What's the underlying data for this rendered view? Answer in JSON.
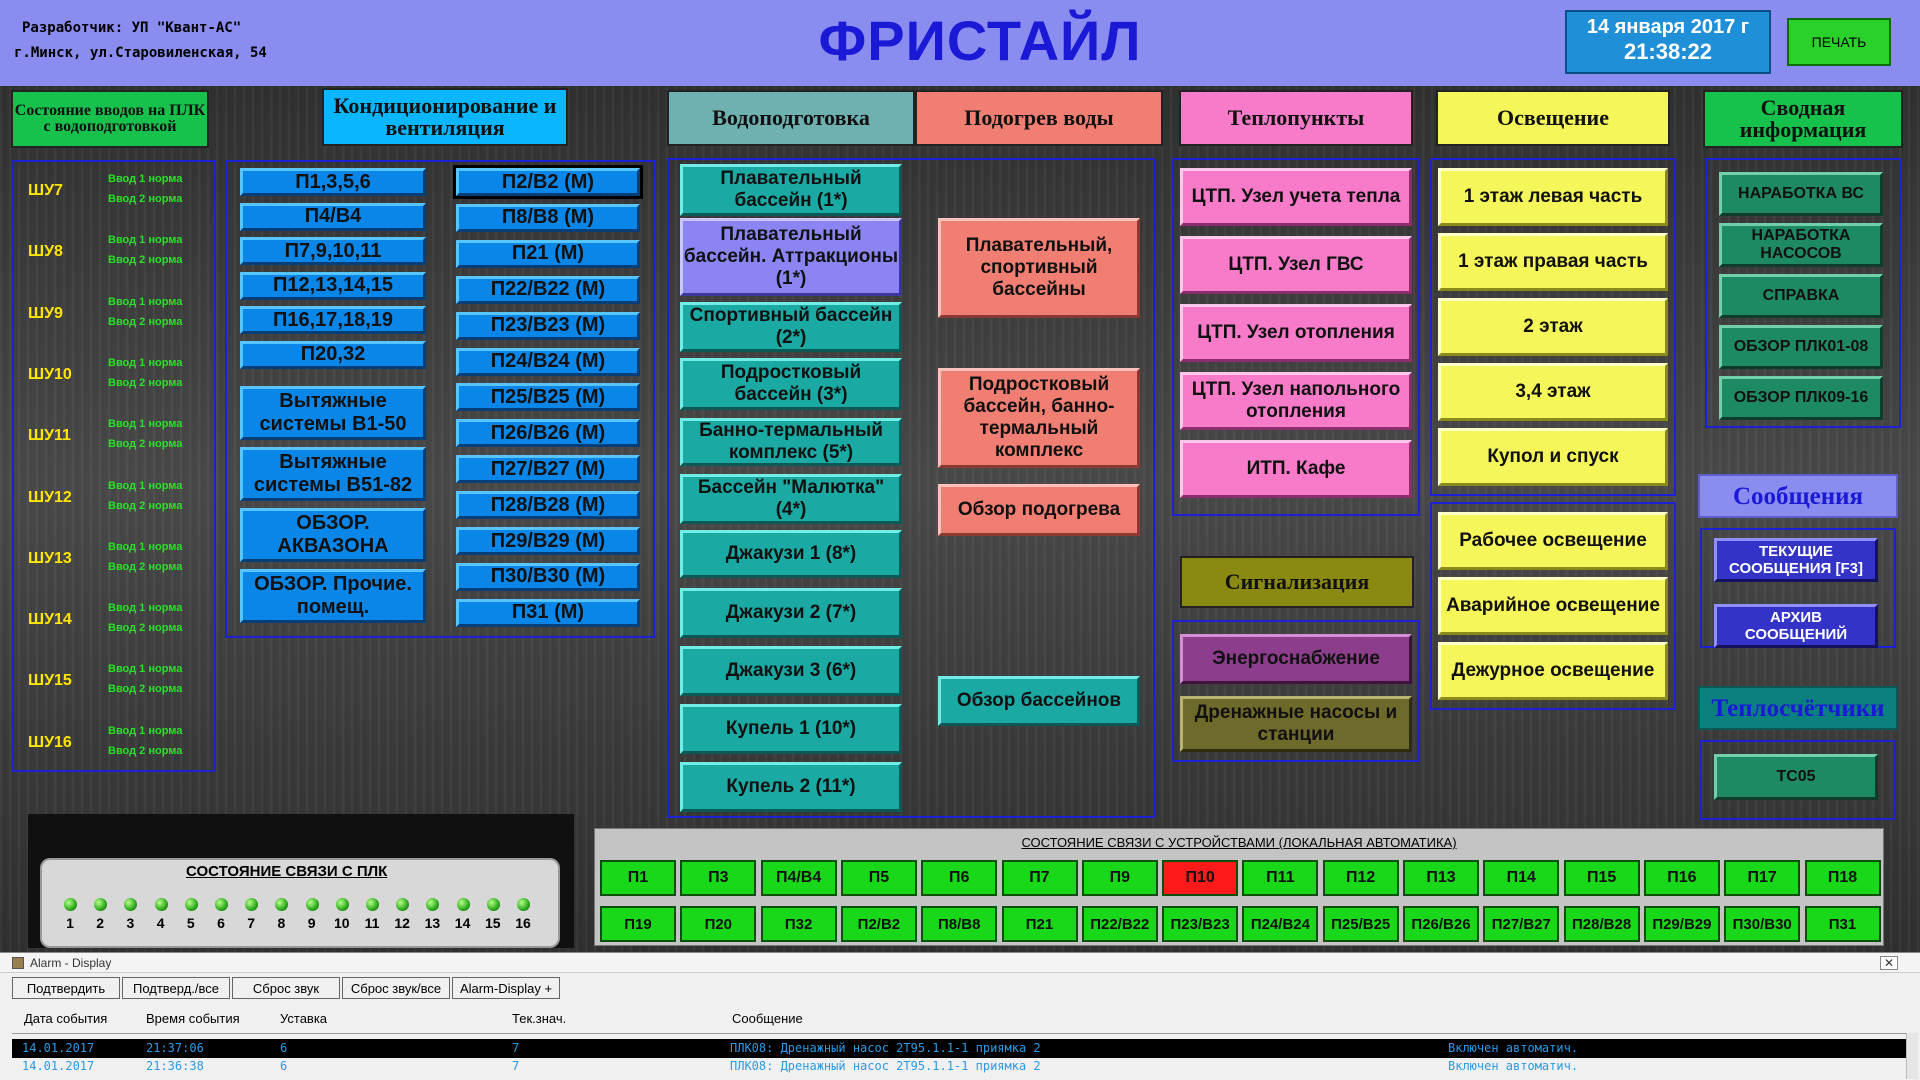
{
  "header": {
    "developer_line1": "Разработчик: УП \"Квант-АС\"",
    "developer_line2": "г.Минск, ул.Старовиленская, 54",
    "title": "ФРИСТАЙЛ",
    "date": "14 января 2017 г",
    "time": "21:38:22",
    "print_label": "ПЕЧАТЬ"
  },
  "colors": {
    "header_bg": "#8a8cf0",
    "title": "#1a1ad6",
    "accent_blue": "#1b22d2",
    "alarm_row_text": "#2a9be5"
  },
  "sections": {
    "inputs_state": "Состояние вводов на ПЛК с водоподготовкой",
    "hvac": "Кондиционирование и вентиляция",
    "water_treatment": "Водоподготовка",
    "water_heating": "Подогрев воды",
    "heat_points": "Теплопункты",
    "lighting": "Освещение",
    "summary": "Сводная информация",
    "messages": "Сообщения",
    "signaling": "Сигнализация",
    "heat_meters": "Теплосчётчики"
  },
  "shu": [
    {
      "label": "ШУ7",
      "in1": "Ввод 1 норма",
      "in2": "Ввод 2 норма"
    },
    {
      "label": "ШУ8",
      "in1": "Ввод 1 норма",
      "in2": "Ввод 2 норма"
    },
    {
      "label": "ШУ9",
      "in1": "Ввод 1 норма",
      "in2": "Ввод 2 норма"
    },
    {
      "label": "ШУ10",
      "in1": "Ввод 1 норма",
      "in2": "Ввод 2 норма"
    },
    {
      "label": "ШУ11",
      "in1": "Ввод 1 норма",
      "in2": "Ввод 2 норма"
    },
    {
      "label": "ШУ12",
      "in1": "Ввод 1 норма",
      "in2": "Ввод 2 норма"
    },
    {
      "label": "ШУ13",
      "in1": "Ввод 1 норма",
      "in2": "Ввод 2 норма"
    },
    {
      "label": "ШУ14",
      "in1": "Ввод 1 норма",
      "in2": "Ввод 2 норма"
    },
    {
      "label": "ШУ15",
      "in1": "Ввод 1 норма",
      "in2": "Ввод 2 норма"
    },
    {
      "label": "ШУ16",
      "in1": "Ввод 1 норма",
      "in2": "Ввод 2 норма"
    }
  ],
  "hvac_left": [
    "П1,3,5,6",
    "П4/В4",
    "П7,9,10,11",
    "П12,13,14,15",
    "П16,17,18,19",
    "П20,32"
  ],
  "hvac_left_big": [
    "Вытяжные системы В1-50",
    "Вытяжные системы В51-82",
    "ОБЗОР. АКВАЗОНА",
    "ОБЗОР. Прочие. помещ."
  ],
  "hvac_right": [
    "П2/В2 (М)",
    "П8/В8 (М)",
    "П21 (М)",
    "П22/В22 (М)",
    "П23/В23 (М)",
    "П24/В24 (М)",
    "П25/В25 (М)",
    "П26/В26 (М)",
    "П27/В27 (М)",
    "П28/В28 (М)",
    "П29/В29 (М)",
    "П30/В30 (М)",
    "П31 (М)"
  ],
  "water": [
    "Плавательный бассейн (1*)",
    "Плавательный бассейн. Аттракционы (1*)",
    "Спортивный бассейн (2*)",
    "Подростковый бассейн (3*)",
    "Банно-термальный комплекс (5*)",
    "Бассейн \"Малютка\" (4*)",
    "Джакузи 1 (8*)",
    "Джакузи 2 (7*)",
    "Джакузи 3 (6*)",
    "Купель 1 (10*)",
    "Купель 2 (11*)"
  ],
  "heating": [
    "Плавательный, спортивный бассейны",
    "Подростковый бассейн, банно-термальный комплекс",
    "Обзор подогрева",
    "Обзор бассейнов"
  ],
  "heat_points": [
    "ЦТП. Узел учета тепла",
    "ЦТП. Узел ГВС",
    "ЦТП. Узел отопления",
    "ЦТП. Узел напольного отопления",
    "ИТП. Кафе"
  ],
  "signaling": [
    "Энергоснабжение",
    "Дренажные насосы и станции"
  ],
  "lighting": [
    "1 этаж левая часть",
    "1 этаж правая часть",
    "2 этаж",
    "3,4 этаж",
    "Купол и спуск"
  ],
  "lighting2": [
    "Рабочее освещение",
    "Аварийное освещение",
    "Дежурное освещение"
  ],
  "summary": [
    "НАРАБОТКА ВС",
    "НАРАБОТКА НАСОСОВ",
    "СПРАВКА",
    "ОБЗОР ПЛК01-08",
    "ОБЗОР ПЛК09-16"
  ],
  "messages": [
    "ТЕКУЩИЕ СООБЩЕНИЯ [F3]",
    "АРХИВ СООБЩЕНИЙ"
  ],
  "heat_meters": [
    "ТС05"
  ],
  "plc": {
    "title": "СОСТОЯНИЕ СВЯЗИ С ПЛК",
    "nums": [
      "1",
      "2",
      "3",
      "4",
      "5",
      "6",
      "7",
      "8",
      "9",
      "10",
      "11",
      "12",
      "13",
      "14",
      "15",
      "16"
    ]
  },
  "devices": {
    "title": "СОСТОЯНИЕ СВЯЗИ С УСТРОЙСТВАМИ (ЛОКАЛЬНАЯ АВТОМАТИКА)",
    "row1": [
      "П1",
      "П3",
      "П4/В4",
      "П5",
      "П6",
      "П7",
      "П9",
      "П10",
      "П11",
      "П12",
      "П13",
      "П14",
      "П15",
      "П16",
      "П17",
      "П18"
    ],
    "row2": [
      "П19",
      "П20",
      "П32",
      "П2/В2",
      "П8/В8",
      "П21",
      "П22/В22",
      "П23/В23",
      "П24/В24",
      "П25/В25",
      "П26/В26",
      "П27/В27",
      "П28/В28",
      "П29/В29",
      "П30/В30",
      "П31"
    ],
    "error": "П10"
  },
  "alarm": {
    "window_title": "Alarm - Display",
    "buttons": [
      "Подтвердить",
      "Подтверд./все",
      "Сброс звук",
      "Сброс звук/все",
      "Alarm-Display +"
    ],
    "columns": [
      "Дата события",
      "Время события",
      "Уставка",
      "Тек.знач.",
      "Сообщение"
    ],
    "rows": [
      {
        "date": "14.01.2017",
        "time": "21:37:06",
        "setpoint": "6",
        "value": "7",
        "message": "ПЛК08: Дренажный насос 2Т95.1.1-1 приямка 2",
        "status": "Включен автоматич."
      },
      {
        "date": "14.01.2017",
        "time": "21:36:38",
        "setpoint": "6",
        "value": "7",
        "message": "ПЛК08: Дренажный насос 2Т95.1.1-1 приямка 2",
        "status": "Включен автоматич."
      }
    ]
  }
}
